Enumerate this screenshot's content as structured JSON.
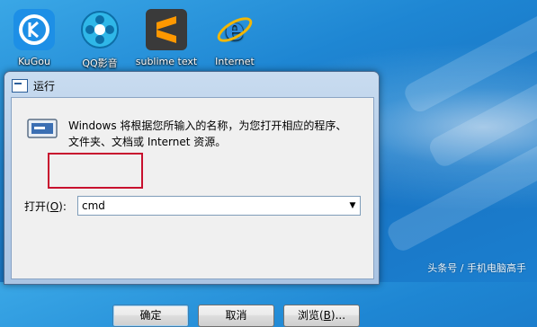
{
  "desktop_icons": [
    {
      "label": "KuGou",
      "icon": "kugou-icon"
    },
    {
      "label": "QQ影音",
      "icon": "qq-player-icon"
    },
    {
      "label": "sublime text",
      "icon": "sublime-text-icon"
    },
    {
      "label": "Internet",
      "icon": "internet-explorer-icon"
    }
  ],
  "dialog": {
    "title": "运行",
    "description": "Windows 将根据您所输入的名称，为您打开相应的程序、文件夹、文档或 Internet 资源。",
    "open_label_prefix": "打开(",
    "open_label_key": "O",
    "open_label_suffix": "):",
    "input_value": "cmd",
    "ok_label": "确定",
    "cancel_label": "取消",
    "browse_label_prefix": "浏览(",
    "browse_label_key": "B",
    "browse_label_suffix": ")..."
  },
  "watermark": "头条号 / 手机电脑高手",
  "colors": {
    "highlight": "#c8102e",
    "desktop": "#1e86d3"
  }
}
